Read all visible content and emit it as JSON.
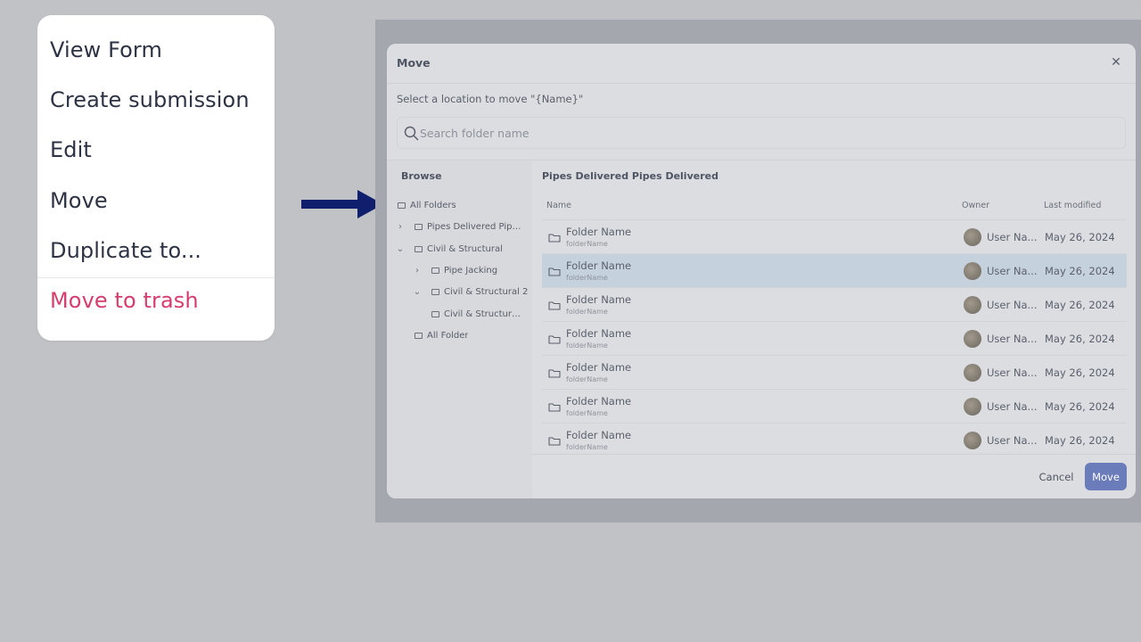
{
  "menu": {
    "items": [
      {
        "label": "View Form"
      },
      {
        "label": "Create submission"
      },
      {
        "label": "Edit"
      },
      {
        "label": "Move"
      },
      {
        "label": "Duplicate to..."
      },
      {
        "label": "Move to trash"
      }
    ]
  },
  "dialog": {
    "title": "Move",
    "subtitle": "Select a location to move \"{Name}\"",
    "search": {
      "placeholder": "Search folder name",
      "value": ""
    },
    "sidebar": {
      "heading": "Browse",
      "tree": [
        {
          "label": "All Folders",
          "chevron": ""
        },
        {
          "label": "Pipes Delivered Pipes...",
          "chevron": "›"
        },
        {
          "label": "Civil & Structural",
          "chevron": "⌄"
        },
        {
          "label": "Pipe Jacking",
          "chevron": "›"
        },
        {
          "label": "Civil & Structural 2",
          "chevron": "⌄"
        },
        {
          "label": "Civil & Structural...",
          "chevron": ""
        },
        {
          "label": "All Folder",
          "chevron": ""
        }
      ]
    },
    "main": {
      "title": "Pipes Delivered Pipes Delivered",
      "columns": {
        "name": "Name",
        "owner": "Owner",
        "modified": "Last modified"
      },
      "rows": [
        {
          "name": "Folder Name",
          "sub": "folderName",
          "owner": "User Na...",
          "date": "May 26, 2024",
          "selected": false
        },
        {
          "name": "Folder Name",
          "sub": "folderName",
          "owner": "User Na...",
          "date": "May 26, 2024",
          "selected": true
        },
        {
          "name": "Folder Name",
          "sub": "folderName",
          "owner": "User Na...",
          "date": "May 26, 2024",
          "selected": false
        },
        {
          "name": "Folder Name",
          "sub": "folderName",
          "owner": "User Na...",
          "date": "May 26, 2024",
          "selected": false
        },
        {
          "name": "Folder Name",
          "sub": "folderName",
          "owner": "User Na...",
          "date": "May 26, 2024",
          "selected": false
        },
        {
          "name": "Folder Name",
          "sub": "folderName",
          "owner": "User Na...",
          "date": "May 26, 2024",
          "selected": false
        },
        {
          "name": "Folder Name",
          "sub": "folderName",
          "owner": "User Na...",
          "date": "May 26, 2024",
          "selected": false
        }
      ]
    },
    "buttons": {
      "cancel": "Cancel",
      "move": "Move"
    },
    "close_icon": "close-icon"
  },
  "colors": {
    "accent": "#6a7cba",
    "danger": "#d63d6e",
    "arrow": "#0f1f6e",
    "selected_row": "#c5d2de"
  }
}
